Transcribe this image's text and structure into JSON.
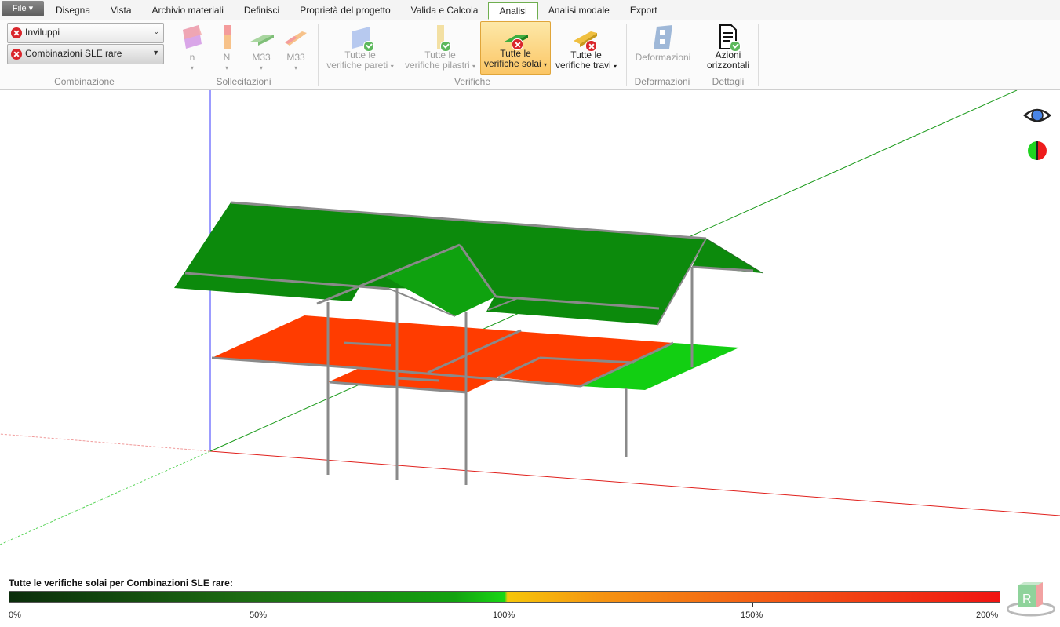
{
  "file_menu": {
    "label": "File"
  },
  "tabs": [
    {
      "label": "Disegna"
    },
    {
      "label": "Vista"
    },
    {
      "label": "Archivio materiali"
    },
    {
      "label": "Definisci"
    },
    {
      "label": "Proprietà del progetto"
    },
    {
      "label": "Valida e Calcola"
    },
    {
      "label": "Analisi",
      "active": true
    },
    {
      "label": "Analisi modale"
    },
    {
      "label": "Export"
    }
  ],
  "ribbon": {
    "combinazione": {
      "group_label": "Combinazione",
      "envelope_select": "Inviluppi",
      "combination_select": "Combinazioni SLE rare"
    },
    "sollecitazioni": {
      "group_label": "Sollecitazioni",
      "buttons": [
        {
          "label": "n"
        },
        {
          "label": "N"
        },
        {
          "label": "M33"
        },
        {
          "label": "M33"
        }
      ]
    },
    "verifiche": {
      "group_label": "Verifiche",
      "walls": {
        "line1": "Tutte le",
        "line2": "verifiche pareti"
      },
      "columns": {
        "line1": "Tutte le",
        "line2": "verifiche pilastri"
      },
      "slabs": {
        "line1": "Tutte le",
        "line2": "verifiche solai"
      },
      "beams": {
        "line1": "Tutte le",
        "line2": "verifiche travi"
      }
    },
    "deformazioni": {
      "group_label": "Deformazioni",
      "button": "Deformazioni"
    },
    "dettagli": {
      "group_label": "Dettagli",
      "line1": "Azioni",
      "line2": "orizzontali"
    }
  },
  "viewport": {
    "icons": [
      "eye-icon",
      "color-toggle-icon"
    ],
    "status_colors": {
      "ok_roof": "#0c8a0c",
      "ok_slab": "#12cf12",
      "fail_slab": "#ff3c00"
    }
  },
  "legend": {
    "title": "Tutte le verifiche solai per Combinazioni SLE rare:",
    "ticks": [
      "0%",
      "50%",
      "100%",
      "150%",
      "200%"
    ],
    "colors": {
      "low": "#0b2d0b",
      "mid": "#19d614",
      "warn": "#f6c60a",
      "high": "#f01412"
    }
  }
}
